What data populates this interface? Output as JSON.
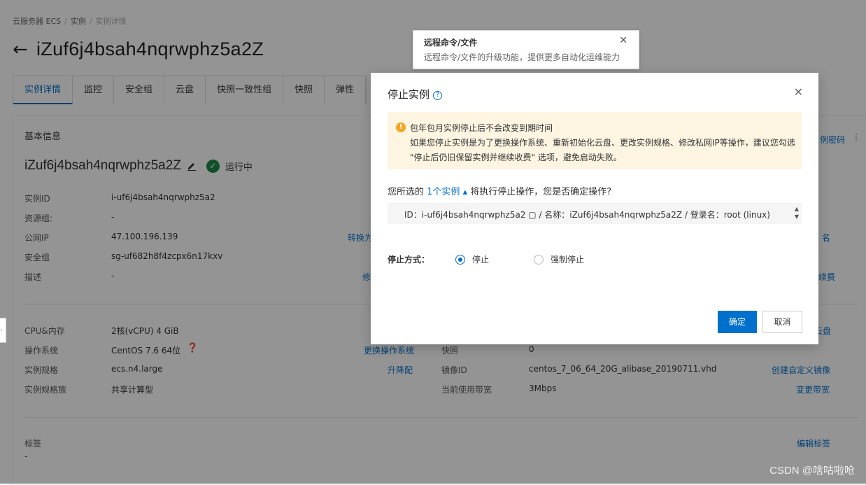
{
  "breadcrumb": [
    "云服务器 ECS",
    "实例",
    "实例详情"
  ],
  "page_title": "iZuf6j4bsah4nqrwphz5a2Z",
  "tabs": [
    "实例详情",
    "监控",
    "安全组",
    "云盘",
    "快照一致性组",
    "快照",
    "弹性"
  ],
  "basic_info": {
    "section_title": "基本信息",
    "instance_name": "iZuf6j4bsah4nqrwphz5a2Z",
    "status": "运行中",
    "rows": [
      {
        "label": "实例ID",
        "value": "i-uf6j4bsah4nqrwphz5a2"
      },
      {
        "label": "资源组:",
        "value": "-"
      },
      {
        "label": "公网IP",
        "value": "47.100.196.139"
      },
      {
        "label": "安全组",
        "value": "sg-uf682h8f4zcpx6n17kxv"
      },
      {
        "label": "描述",
        "value": "-"
      }
    ],
    "partial_actions": {
      "convert": "转换为",
      "modify": "修",
      "password": "例密码",
      "name": "名",
      "renew": "续费"
    }
  },
  "config": {
    "rows": [
      {
        "label": "CPU&内存",
        "value": "2核(vCPU) 4 GiB"
      },
      {
        "label": "操作系统",
        "value": "CentOS 7.6 64位"
      },
      {
        "label": "实例规格",
        "value": "ecs.n4.large"
      },
      {
        "label": "实例规格族",
        "value": "共享计算型"
      }
    ],
    "change_os": "更换操作系统",
    "upgrade": "升降配",
    "snapshot_label": "快照",
    "snapshot_value": "0",
    "image_label": "镜像ID",
    "image_value": "centos_7_06_64_20G_alibase_20190711.vhd",
    "bandwidth_label": "当前使用带宽",
    "bandwidth_value": "3Mbps",
    "create_image": "创建自定义镜像",
    "change_bandwidth": "变更带宽",
    "disk_partial": "云盘"
  },
  "tags": {
    "label": "标签",
    "value": "-",
    "edit": "编辑标签"
  },
  "tooltip": {
    "title": "远程命令/文件",
    "desc": "远程命令/文件的升级功能，提供更多自动化运维能力"
  },
  "modal": {
    "title": "停止实例",
    "warning_lines": [
      "包年包月实例停止后不会改变到期时间",
      "如果您停止实例是为了更换操作系统、重新初始化云盘、更改实例规格、修改私网IP等操作，建议您勾选",
      "\"停止后仍旧保留实例并继续收费\" 选项，避免启动失败。"
    ],
    "confirm_prefix": "您所选的",
    "confirm_link": "1个实例",
    "confirm_suffix": "将执行停止操作，您是否确定操作?",
    "instance_line": "ID：i-uf6j4bsah4nqrwphz5a2 ▢ / 名称：iZuf6j4bsah4nqrwphz5a2Z / 登录名：root (linux)",
    "stop_mode_label": "停止方式：",
    "option_stop": "停止",
    "option_force": "强制停止",
    "selected_option": "停止",
    "ok": "确定",
    "cancel": "取消"
  },
  "watermark": "CSDN @啥咕啦呛"
}
